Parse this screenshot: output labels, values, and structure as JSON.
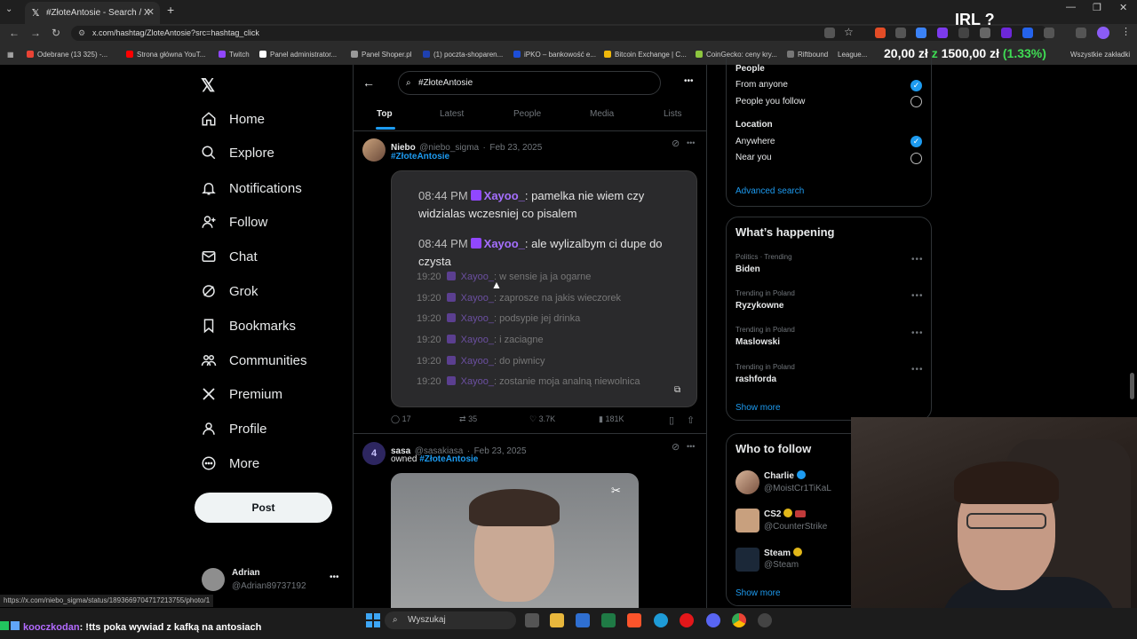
{
  "browser": {
    "tab_title": "#ZłoteAntosie - Search / X",
    "url": "x.com/hashtag/ZloteAntosie?src=hashtag_click",
    "bookmarks": [
      "Odebrane (13 325) -...",
      "Strona główna YouT...",
      "Twitch",
      "Panel administrator...",
      "Panel Shoper.pl",
      "(1) poczta-shoparen...",
      "iPKO – bankowość e...",
      "Bitcoin Exchange | C...",
      "CoinGecko: ceny kry...",
      "Riftbound",
      "League...",
      "Wszystkie zakładki"
    ],
    "status_url": "https://x.com/niebo_sigma/status/1893669704717213755/photo/1"
  },
  "overlay": {
    "irl": "IRL ?",
    "ticker_left": "20,00 zł",
    "ticker_mid": "z",
    "ticker_amount": "1500,00 zł",
    "ticker_pct": "(1.33%)"
  },
  "sidebar": {
    "items": [
      {
        "label": "Home",
        "icon": "home-icon"
      },
      {
        "label": "Explore",
        "icon": "search-icon"
      },
      {
        "label": "Notifications",
        "icon": "bell-icon"
      },
      {
        "label": "Follow",
        "icon": "add-person-icon"
      },
      {
        "label": "Chat",
        "icon": "mail-icon"
      },
      {
        "label": "Grok",
        "icon": "grok-icon"
      },
      {
        "label": "Bookmarks",
        "icon": "bookmark-icon"
      },
      {
        "label": "Communities",
        "icon": "communities-icon"
      },
      {
        "label": "Premium",
        "icon": "x-icon"
      },
      {
        "label": "Profile",
        "icon": "person-icon"
      },
      {
        "label": "More",
        "icon": "more-circle-icon"
      }
    ],
    "post_label": "Post",
    "user_name": "Adrian",
    "user_handle": "@Adrian89737192"
  },
  "search": {
    "query": "#ZłoteAntosie",
    "tabs": [
      "Top",
      "Latest",
      "People",
      "Media",
      "Lists"
    ]
  },
  "tweets": [
    {
      "name": "Niebo",
      "handle": "@niebo_sigma",
      "date": "Feb 23, 2025",
      "hashtag": "#ZłoteAntosie",
      "replies": "17",
      "reposts": "35",
      "likes": "3.7K",
      "views": "181K",
      "chat": {
        "big": [
          {
            "time": "08:44 PM",
            "user": "Xayoo_",
            "text": ": pamelka nie wiem czy widzialas wczesniej co pisalem"
          },
          {
            "time": "08:44 PM",
            "user": "Xayoo_",
            "text": ": ale wylizalbym ci dupe do czysta"
          }
        ],
        "small": [
          {
            "time": "19:20",
            "user": "Xayoo_",
            "text": ": w sensie ja ja ogarne"
          },
          {
            "time": "19:20",
            "user": "Xayoo_",
            "text": ": zaprosze na jakis wieczorek"
          },
          {
            "time": "19:20",
            "user": "Xayoo_",
            "text": ": podsypie jej drinka"
          },
          {
            "time": "19:20",
            "user": "Xayoo_",
            "text": ": i zaciagne"
          },
          {
            "time": "19:20",
            "user": "Xayoo_",
            "text": ": do piwnicy"
          },
          {
            "time": "19:20",
            "user": "Xayoo_",
            "text": ": zostanie moja analną niewolnica"
          }
        ]
      }
    },
    {
      "name": "sasa",
      "handle": "@sasakiasa",
      "date": "Feb 23, 2025",
      "text_prefix": "owned",
      "hashtag": "#ZłoteAntosie"
    }
  ],
  "filters": {
    "people_heading": "People",
    "from_anyone": "From anyone",
    "people_you_follow": "People you follow",
    "location_heading": "Location",
    "anywhere": "Anywhere",
    "near_you": "Near you",
    "advanced_search": "Advanced search"
  },
  "trends": {
    "heading": "What’s happening",
    "items": [
      {
        "meta": "Politics · Trending",
        "name": "Biden"
      },
      {
        "meta": "Trending in Poland",
        "name": "Ryzykowne"
      },
      {
        "meta": "Trending in Poland",
        "name": "Maslowski"
      },
      {
        "meta": "Trending in Poland",
        "name": "rashforda"
      }
    ],
    "show_more": "Show more"
  },
  "who_to_follow": {
    "heading": "Who to follow",
    "items": [
      {
        "name": "Charlie",
        "handle": "@MoistCr1TiKaL"
      },
      {
        "name": "CS2",
        "handle": "@CounterStrike"
      },
      {
        "name": "Steam",
        "handle": "@Steam"
      }
    ],
    "show_more": "Show more"
  },
  "taskbar": {
    "search_placeholder": "Wyszukaj"
  },
  "stream_chat": {
    "user": "kooczkodan",
    "message": ": !tts poka wywiad z kafką na antosiach"
  },
  "colors": {
    "accent": "#1d9bf0",
    "background": "#000000",
    "twitch_purple": "#9147ff"
  }
}
